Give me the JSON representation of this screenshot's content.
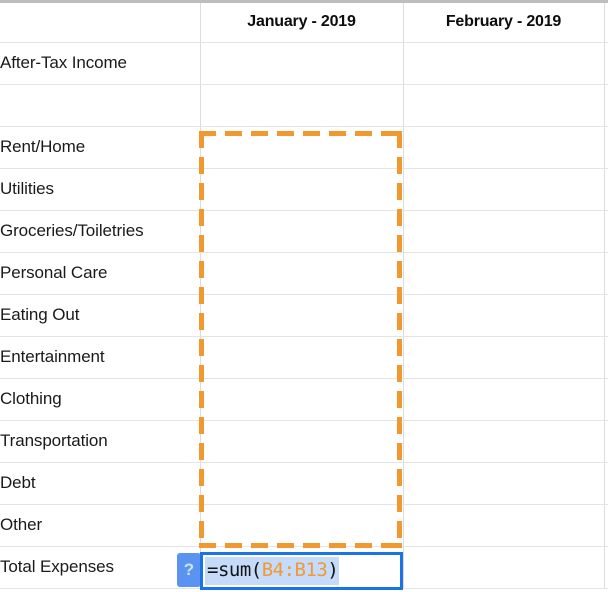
{
  "app": {
    "type": "spreadsheet",
    "accent_blue": "#1a73e8",
    "marquee_orange": "#f1992f",
    "selection_highlight": "#c5dbf9",
    "ref_color": "#ef9a34",
    "grid_line": "#e4e4e4"
  },
  "columns": [
    {
      "key": "label",
      "header": ""
    },
    {
      "key": "jan",
      "header": "January - 2019"
    },
    {
      "key": "feb",
      "header": "February - 2019"
    }
  ],
  "rows": [
    {
      "label": "After-Tax Income",
      "jan": "",
      "feb": ""
    },
    {
      "label": "",
      "jan": "",
      "feb": ""
    },
    {
      "label": "Rent/Home",
      "jan": "",
      "feb": ""
    },
    {
      "label": "Utilities",
      "jan": "",
      "feb": ""
    },
    {
      "label": "Groceries/Toiletries",
      "jan": "",
      "feb": ""
    },
    {
      "label": "Personal Care",
      "jan": "",
      "feb": ""
    },
    {
      "label": "Eating Out",
      "jan": "",
      "feb": ""
    },
    {
      "label": "Entertainment",
      "jan": "",
      "feb": ""
    },
    {
      "label": "Clothing",
      "jan": "",
      "feb": ""
    },
    {
      "label": "Transportation",
      "jan": "",
      "feb": ""
    },
    {
      "label": "Debt",
      "jan": "",
      "feb": ""
    },
    {
      "label": "Other",
      "jan": "",
      "feb": ""
    },
    {
      "label": "Total Expenses",
      "jan": "",
      "feb": ""
    }
  ],
  "editor": {
    "help_badge_label": "?",
    "formula_prefix": "=sum(",
    "formula_range": "B4:B13",
    "formula_suffix": ")",
    "formula_full": "=sum(B4:B13)"
  },
  "marquee": {
    "range": "B4:B13",
    "style": "dashed"
  }
}
